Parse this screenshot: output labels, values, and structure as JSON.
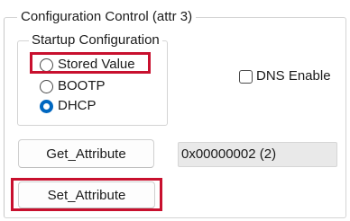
{
  "configuration_control": {
    "title": "Configuration Control (attr 3)",
    "startup_configuration": {
      "title": "Startup Configuration",
      "options": [
        {
          "label": "Stored Value",
          "checked": false
        },
        {
          "label": "BOOTP",
          "checked": false
        },
        {
          "label": "DHCP",
          "checked": true
        }
      ]
    },
    "dns_enable": {
      "label": "DNS Enable",
      "checked": false
    },
    "get_attribute_label": "Get_Attribute",
    "attribute_value": "0x00000002 (2)",
    "set_attribute_label": "Set_Attribute"
  },
  "colors": {
    "highlight": "#c8102e",
    "radio_checked": "#0067c0",
    "value_field_bg": "#e9e9e9"
  }
}
